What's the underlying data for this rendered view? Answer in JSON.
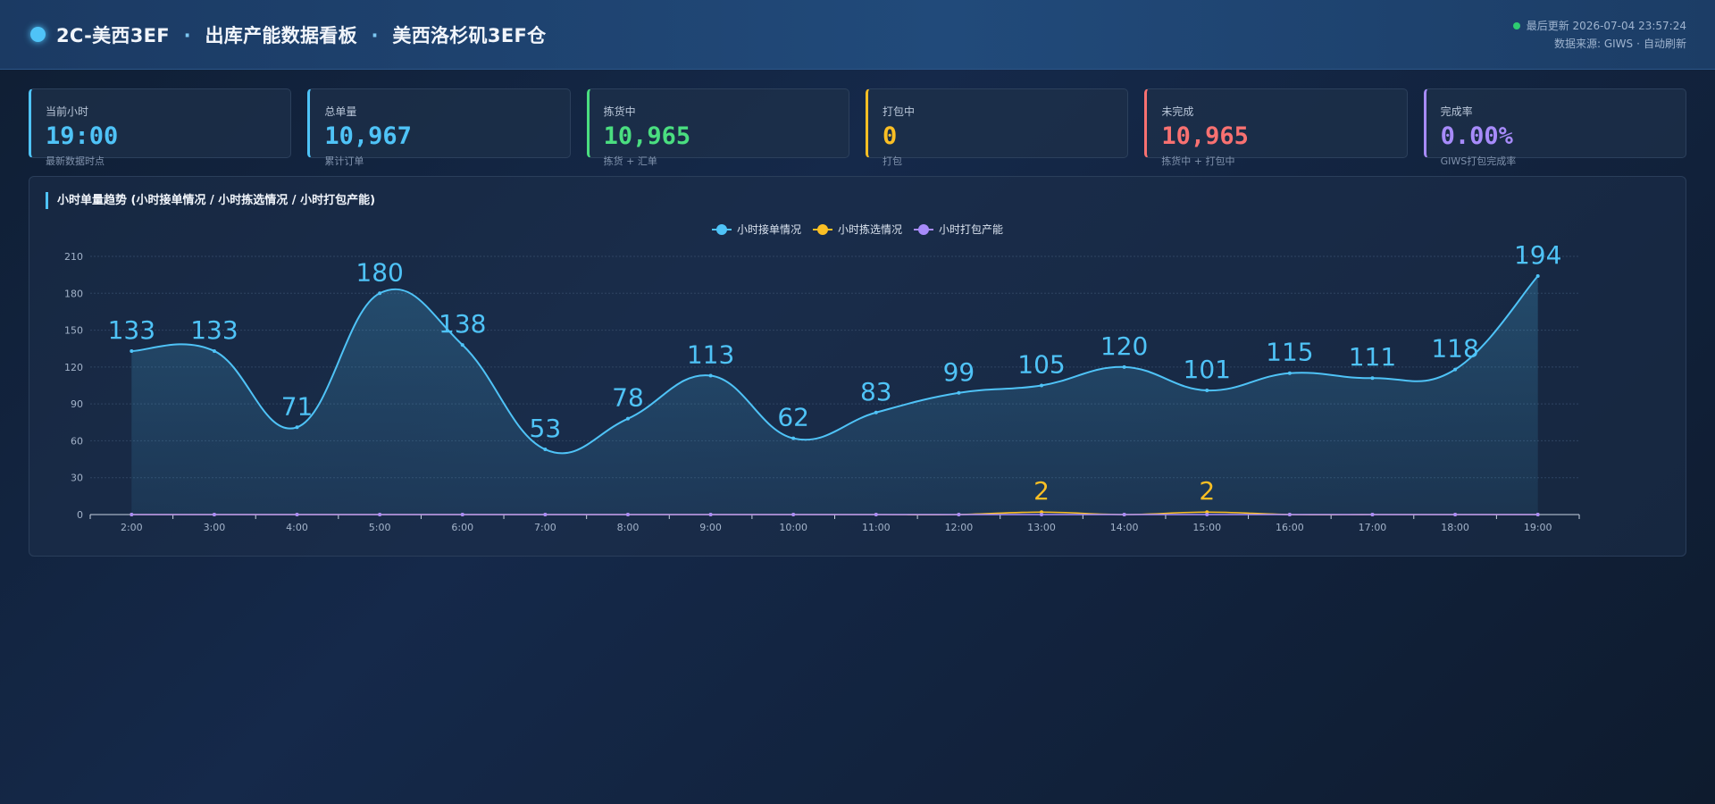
{
  "header": {
    "title_part1": "2C-美西3EF",
    "title_sep": "·",
    "title_part2": "出库产能数据看板",
    "title_part3": "美西洛杉矶3EF仓",
    "last_update_label": "最后更新",
    "last_update_value": "2026-07-04 23:57:24",
    "source_label": "数据来源: GIWS",
    "source_sep": "·",
    "auto_refresh": "自动刷新"
  },
  "kpis": [
    {
      "label": "当前小时",
      "value": "19:00",
      "sub": "最新数据时点",
      "color": "#4fc3f7"
    },
    {
      "label": "总单量",
      "value": "10,967",
      "sub": "累计订单",
      "color": "#4fc3f7"
    },
    {
      "label": "拣货中",
      "value": "10,965",
      "sub": "拣货 + 汇单",
      "color": "#4ade80"
    },
    {
      "label": "打包中",
      "value": "0",
      "sub": "打包",
      "color": "#fbbf24"
    },
    {
      "label": "未完成",
      "value": "10,965",
      "sub": "拣货中 + 打包中",
      "color": "#f87171"
    },
    {
      "label": "完成率",
      "value": "0.00%",
      "sub": "GIWS打包完成率",
      "color": "#a78bfa"
    }
  ],
  "panel": {
    "title": "小时单量趋势 (小时接单情况 / 小时拣选情况 / 小时打包产能)"
  },
  "chart_data": {
    "type": "line",
    "x": [
      "2:00",
      "3:00",
      "4:00",
      "5:00",
      "6:00",
      "7:00",
      "8:00",
      "9:00",
      "10:00",
      "11:00",
      "12:00",
      "13:00",
      "14:00",
      "15:00",
      "16:00",
      "17:00",
      "18:00",
      "19:00"
    ],
    "ylim": [
      0,
      210
    ],
    "yticks": [
      0,
      30,
      60,
      90,
      120,
      150,
      180,
      210
    ],
    "grid": true,
    "legend_position": "top-center",
    "series": [
      {
        "name": "小时接单情况",
        "color": "#4fc3f7",
        "area": true,
        "show_labels": true,
        "values": [
          133,
          133,
          71,
          180,
          138,
          53,
          78,
          113,
          62,
          83,
          99,
          105,
          120,
          101,
          115,
          111,
          118,
          194
        ]
      },
      {
        "name": "小时拣选情况",
        "color": "#fbbf24",
        "area": false,
        "show_labels": true,
        "values": [
          0,
          0,
          0,
          0,
          0,
          0,
          0,
          0,
          0,
          0,
          0,
          2,
          0,
          2,
          0,
          0,
          0,
          0
        ]
      },
      {
        "name": "小时打包产能",
        "color": "#a78bfa",
        "area": false,
        "show_labels": false,
        "values": [
          0,
          0,
          0,
          0,
          0,
          0,
          0,
          0,
          0,
          0,
          0,
          0,
          0,
          0,
          0,
          0,
          0,
          0
        ]
      }
    ]
  }
}
